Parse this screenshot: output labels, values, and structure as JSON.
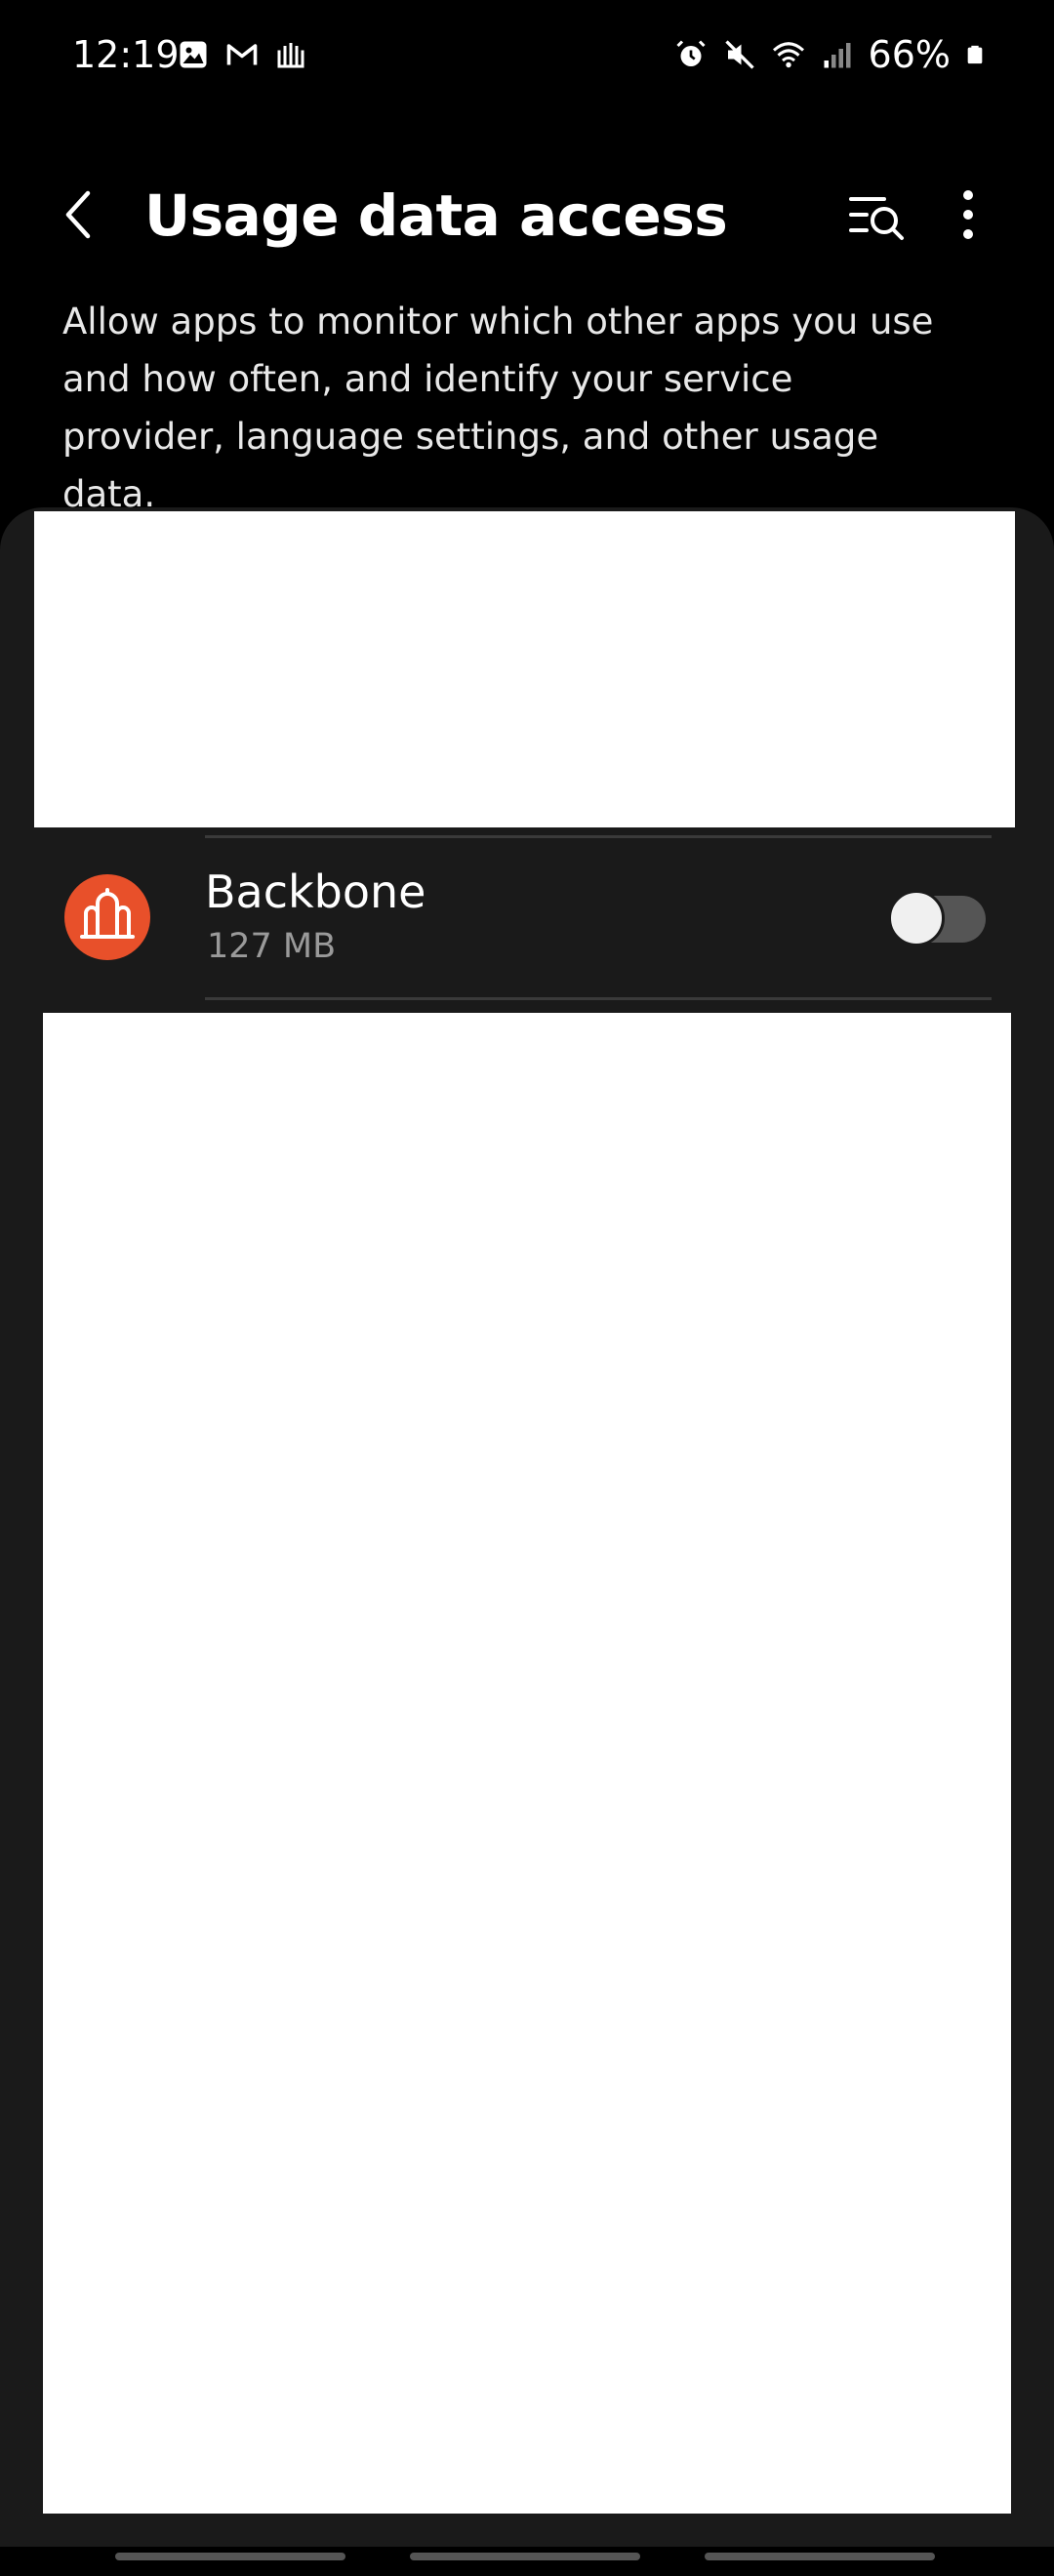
{
  "status_bar": {
    "time": "12:19",
    "battery_percent": "66%",
    "left_icons": [
      "gallery-icon",
      "gmail-icon",
      "backbone-notification-icon"
    ],
    "right_icons": [
      "alarm-icon",
      "mute-icon",
      "wifi-icon",
      "signal-icon",
      "battery-icon"
    ]
  },
  "app_bar": {
    "title": "Usage data access",
    "back_icon": "back-chevron-icon",
    "search_icon": "list-search-icon",
    "more_icon": "more-vert-icon"
  },
  "description": "Allow apps to monitor which other apps you use and how often, and identify your service provider, language settings, and other usage data.",
  "apps": [
    {
      "name": "Backbone",
      "size": "127 MB",
      "enabled": false,
      "icon": "backbone-app-icon",
      "icon_color": "#e8502a"
    }
  ],
  "colors": {
    "background": "#000000",
    "card": "#1a1a1a",
    "secondary_text": "#9a9a9a",
    "toggle_off_track": "#555555"
  }
}
